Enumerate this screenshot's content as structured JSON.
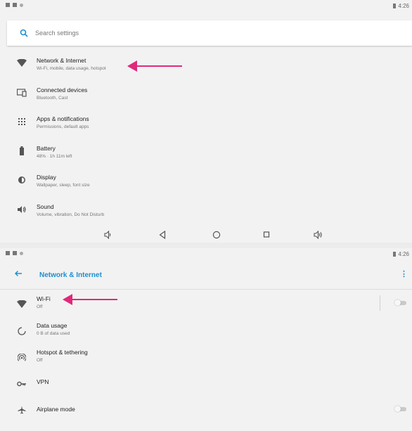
{
  "status": {
    "time": "4:26"
  },
  "search": {
    "placeholder": "Search settings"
  },
  "settings": {
    "items": [
      {
        "title": "Network & Internet",
        "subtitle": "Wi-Fi, mobile, data usage, hotspot",
        "icon": "wifi-icon"
      },
      {
        "title": "Connected devices",
        "subtitle": "Bluetooth, Cast",
        "icon": "devices-icon"
      },
      {
        "title": "Apps & notifications",
        "subtitle": "Permissions, default apps",
        "icon": "apps-icon"
      },
      {
        "title": "Battery",
        "subtitle": "48% · 1h 11m left",
        "icon": "battery-icon"
      },
      {
        "title": "Display",
        "subtitle": "Wallpaper, sleep, font size",
        "icon": "brightness-icon"
      },
      {
        "title": "Sound",
        "subtitle": "Volume, vibration, Do Not Disturb",
        "icon": "volume-icon"
      }
    ]
  },
  "network": {
    "title": "Network & Internet",
    "items": [
      {
        "title": "Wi-Fi",
        "subtitle": "Off",
        "icon": "wifi-icon",
        "toggle": false
      },
      {
        "title": "Data usage",
        "subtitle": "0 B of data used",
        "icon": "data-usage-icon"
      },
      {
        "title": "Hotspot & tethering",
        "subtitle": "Off",
        "icon": "hotspot-icon"
      },
      {
        "title": "VPN",
        "subtitle": "",
        "icon": "vpn-key-icon"
      },
      {
        "title": "Airplane mode",
        "subtitle": "",
        "icon": "airplane-icon",
        "toggle": false
      }
    ]
  },
  "colors": {
    "accent": "#1d8fce",
    "annotation_arrow": "#e0297b"
  }
}
